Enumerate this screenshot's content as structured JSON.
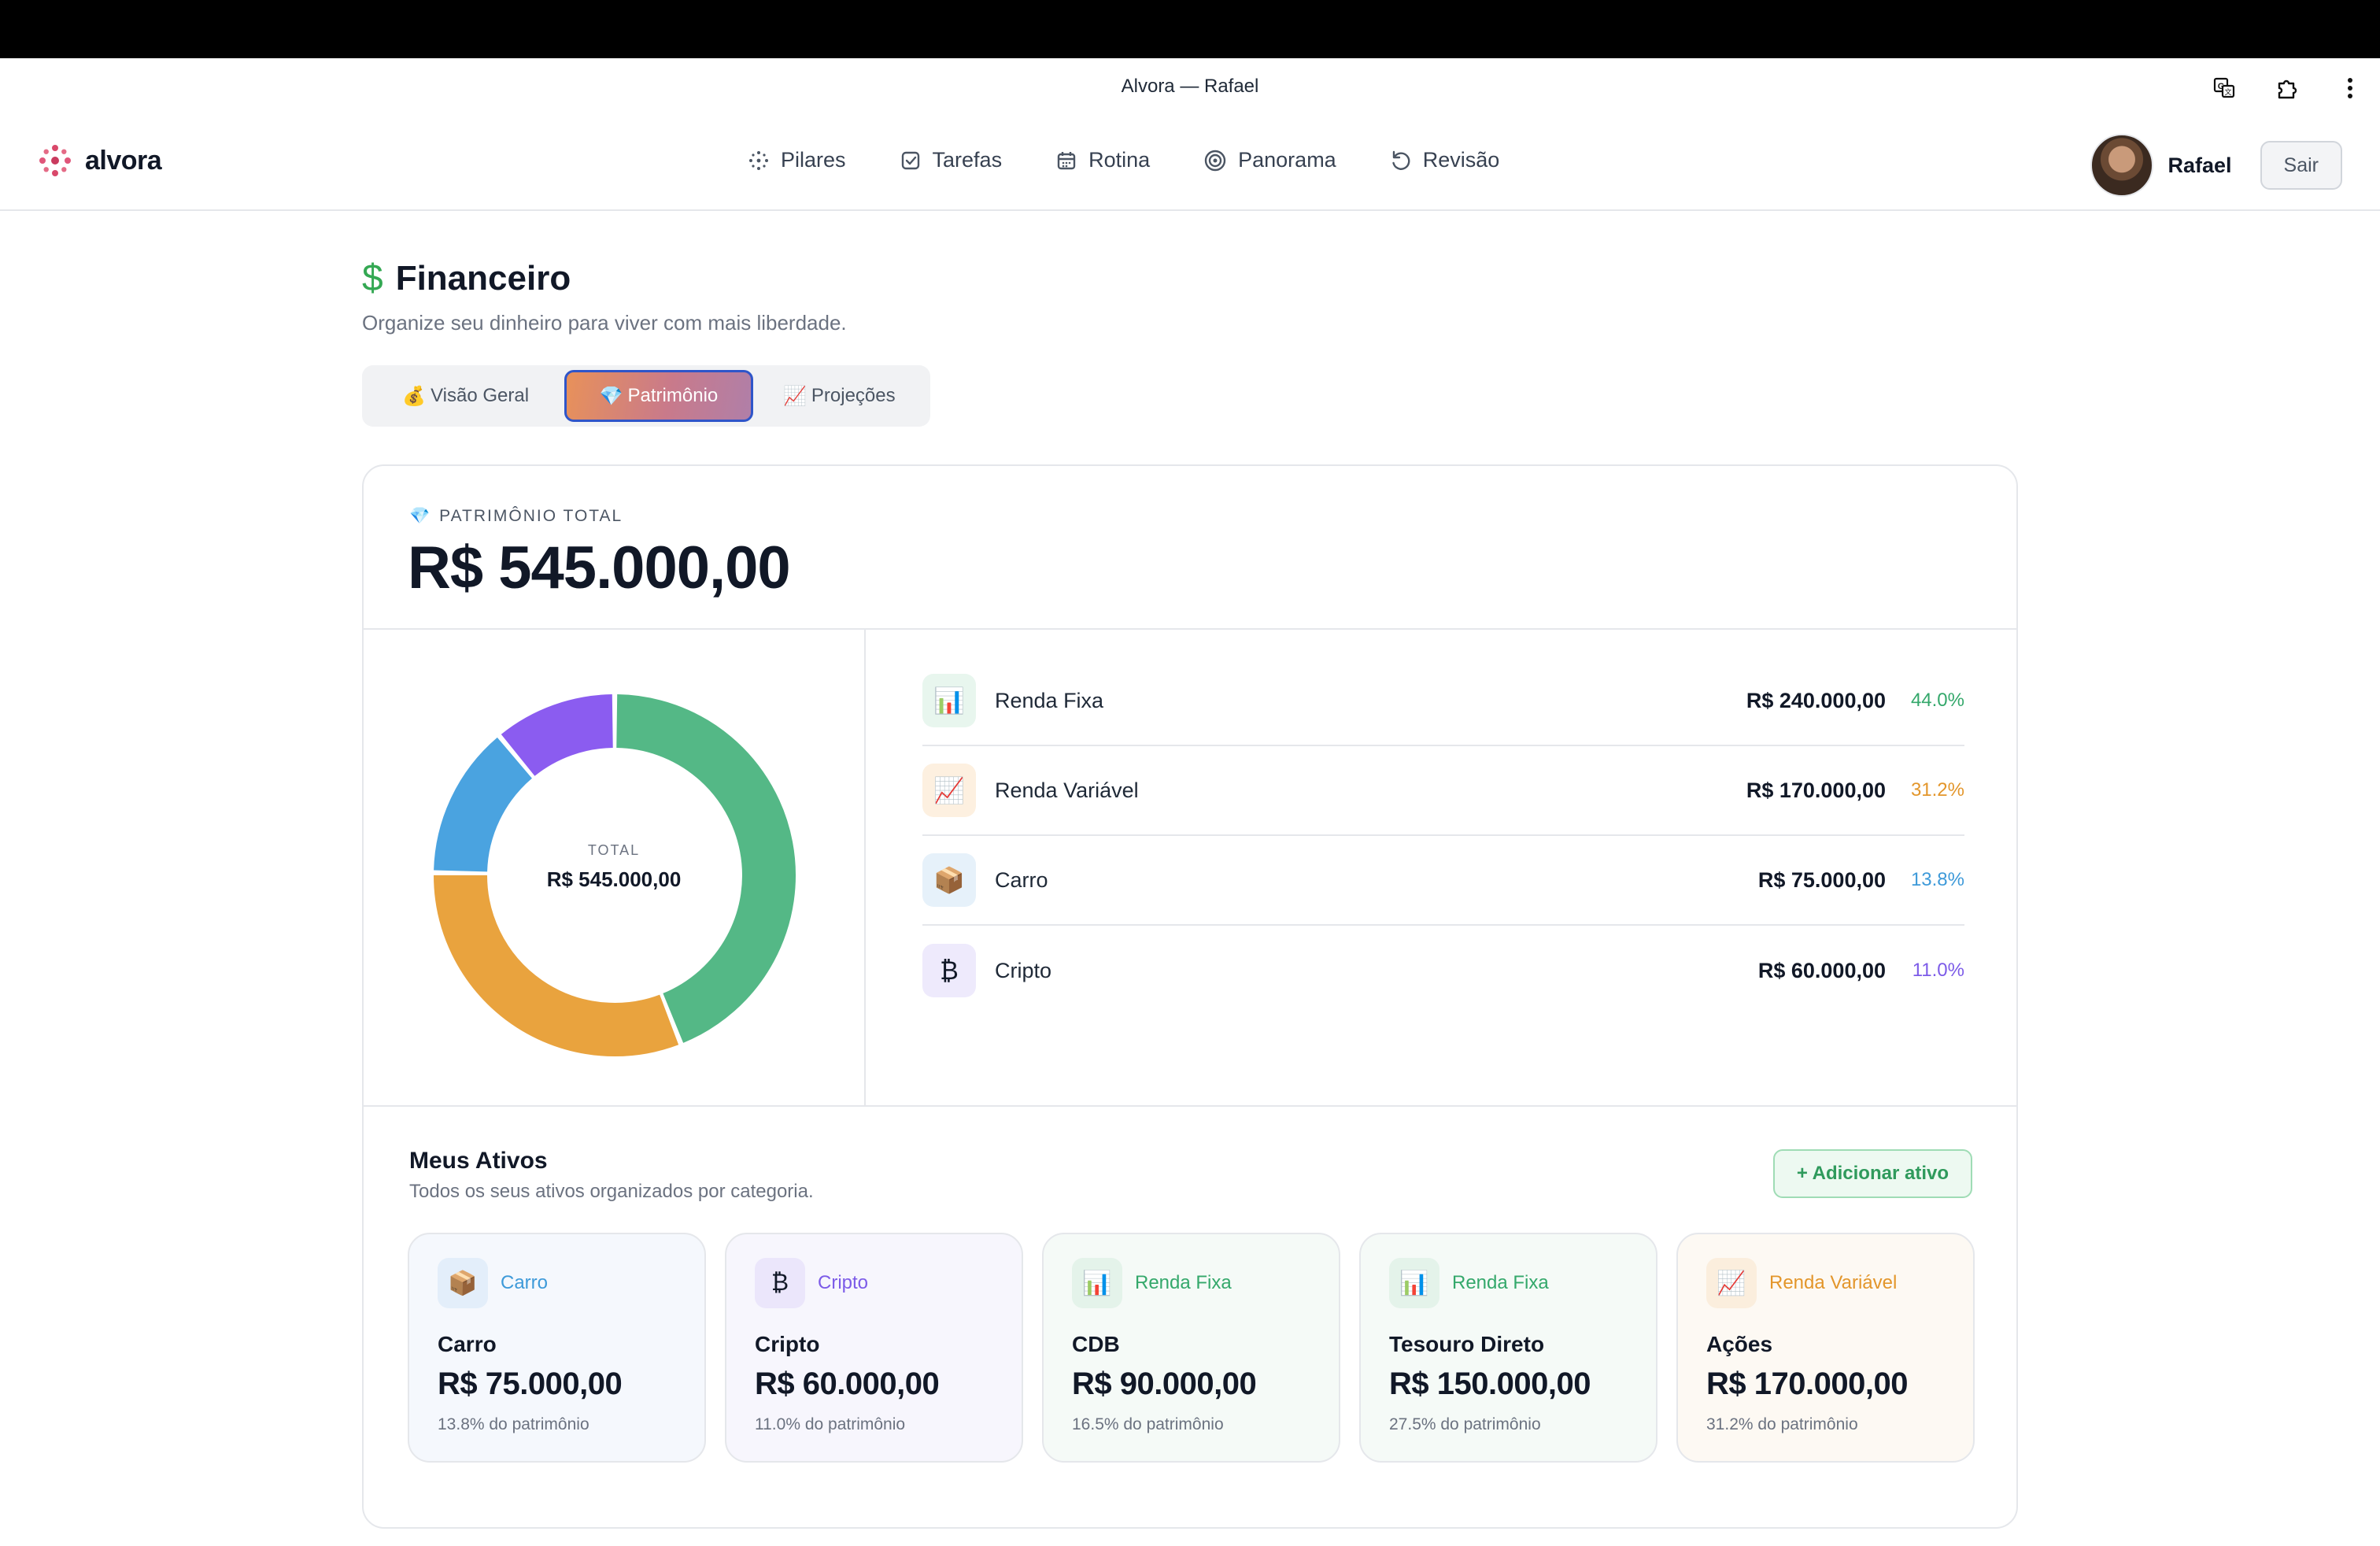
{
  "window": {
    "title": "Alvora — Rafael",
    "icons": [
      "translate-icon",
      "extension-icon",
      "more-vert-icon"
    ]
  },
  "app": {
    "logo_text": "alvora",
    "nav": [
      {
        "label": "Pilares",
        "icon": "pillars-icon"
      },
      {
        "label": "Tarefas",
        "icon": "checkbox-icon"
      },
      {
        "label": "Rotina",
        "icon": "calendar-icon"
      },
      {
        "label": "Panorama",
        "icon": "target-icon"
      },
      {
        "label": "Revisão",
        "icon": "refresh-icon"
      }
    ],
    "user_name": "Rafael",
    "logout_label": "Sair"
  },
  "page": {
    "icon": "$",
    "title": "Financeiro",
    "subtitle": "Organize seu dinheiro para viver com mais liberdade.",
    "tabs": [
      {
        "emoji": "💰",
        "label": "Visão Geral",
        "active": false
      },
      {
        "emoji": "💎",
        "label": "Patrimônio",
        "active": true
      },
      {
        "emoji": "📈",
        "label": "Projeções",
        "active": false
      }
    ]
  },
  "summary": {
    "label_emoji": "💎",
    "label": "PATRIMÔNIO TOTAL",
    "value": "R$ 545.000,00",
    "center_label": "TOTAL",
    "center_value": "R$ 545.000,00"
  },
  "breakdown": [
    {
      "emoji": "📊",
      "name": "Renda Fixa",
      "value": "R$ 240.000,00",
      "pct": "44.0%",
      "color": "#34a86b",
      "bg": "#e8f6ee"
    },
    {
      "emoji": "📈",
      "name": "Renda Variável",
      "value": "R$ 170.000,00",
      "pct": "31.2%",
      "color": "#e3962b",
      "bg": "#fdf0e0"
    },
    {
      "emoji": "📦",
      "name": "Carro",
      "value": "R$ 75.000,00",
      "pct": "13.8%",
      "color": "#3e9ad9",
      "bg": "#e6f1fa"
    },
    {
      "emoji": "₿",
      "name": "Cripto",
      "value": "R$ 60.000,00",
      "pct": "11.0%",
      "color": "#7c5be8",
      "bg": "#eeeafc"
    }
  ],
  "chart_data": {
    "type": "pie",
    "categories": [
      "Renda Fixa",
      "Renda Variável",
      "Carro",
      "Cripto"
    ],
    "values": [
      240000,
      170000,
      75000,
      60000
    ],
    "colors": [
      "#54b886",
      "#e9a33e",
      "#4aa3e0",
      "#8b5cf0"
    ]
  },
  "assets": {
    "title": "Meus Ativos",
    "subtitle": "Todos os seus ativos organizados por categoria.",
    "add_label": "+ Adicionar ativo",
    "items": [
      {
        "emoji": "📦",
        "category": "Carro",
        "name": "Carro",
        "value": "R$ 75.000,00",
        "pct": "13.8% do patrimônio",
        "color": "#3e9ad9",
        "icon_bg": "#e3eefa",
        "card_bg": "#f5f8fd"
      },
      {
        "emoji": "₿",
        "category": "Cripto",
        "name": "Cripto",
        "value": "R$ 60.000,00",
        "pct": "11.0% do patrimônio",
        "color": "#7c5be8",
        "icon_bg": "#ebe6fb",
        "card_bg": "#f7f6fd"
      },
      {
        "emoji": "📊",
        "category": "Renda Fixa",
        "name": "CDB",
        "value": "R$ 90.000,00",
        "pct": "16.5% do patrimônio",
        "color": "#34a86b",
        "icon_bg": "#e4f3ea",
        "card_bg": "#f5faf7"
      },
      {
        "emoji": "📊",
        "category": "Renda Fixa",
        "name": "Tesouro Direto",
        "value": "R$ 150.000,00",
        "pct": "27.5% do patrimônio",
        "color": "#34a86b",
        "icon_bg": "#e4f3ea",
        "card_bg": "#f5faf7"
      },
      {
        "emoji": "📈",
        "category": "Renda Variável",
        "name": "Ações",
        "value": "R$ 170.000,00",
        "pct": "31.2% do patrimônio",
        "color": "#e3962b",
        "icon_bg": "#fbeedd",
        "card_bg": "#fdf9f3"
      }
    ]
  }
}
